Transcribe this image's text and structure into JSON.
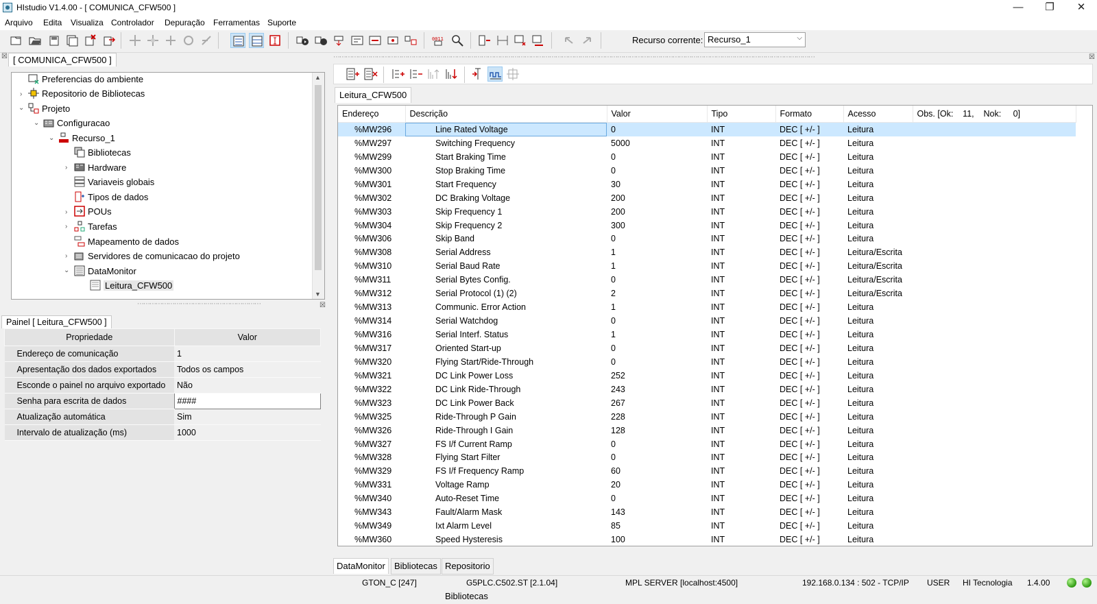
{
  "window": {
    "title": "HIstudio V1.4.00 - [ COMUNICA_CFW500 ]"
  },
  "menu": [
    "Arquivo",
    "Edita",
    "Visualiza",
    "Controlador",
    "Depuração",
    "Ferramentas",
    "Suporte"
  ],
  "toolbar": {
    "resource_label": "Recurso corrente:",
    "resource_value": "Recurso_1"
  },
  "left": {
    "project_tab": "[ COMUNICA_CFW500 ]",
    "tree": [
      {
        "label": "Preferencias do ambiente",
        "icon": "preferences-icon"
      },
      {
        "label": "Repositorio de Bibliotecas",
        "icon": "repository-icon"
      },
      {
        "label": "Projeto",
        "icon": "project-icon"
      },
      {
        "label": "Configuracao",
        "icon": "configuration-icon"
      },
      {
        "label": "Recurso_1",
        "icon": "resource-icon"
      },
      {
        "label": "Bibliotecas",
        "icon": "libraries-icon"
      },
      {
        "label": "Hardware",
        "icon": "hardware-icon"
      },
      {
        "label": "Variaveis globais",
        "icon": "global-variables-icon"
      },
      {
        "label": "Tipos de dados",
        "icon": "data-types-icon"
      },
      {
        "label": "POUs",
        "icon": "pous-icon"
      },
      {
        "label": "Tarefas",
        "icon": "tasks-icon"
      },
      {
        "label": "Mapeamento de dados",
        "icon": "data-mapping-icon"
      },
      {
        "label": "Servidores de comunicacao do projeto",
        "icon": "comm-servers-icon"
      },
      {
        "label": "DataMonitor",
        "icon": "datamonitor-icon"
      },
      {
        "label": "Leitura_CFW500",
        "icon": "panel-icon"
      }
    ],
    "panel_tab": "Painel [ Leitura_CFW500 ]",
    "props_headers": [
      "Propriedade",
      "Valor"
    ],
    "props": [
      {
        "name": "Endereço de comunicação",
        "value": "1"
      },
      {
        "name": "Apresentação dos dados exportados",
        "value": "Todos os campos"
      },
      {
        "name": "Esconde o painel no arquivo exportado",
        "value": "Não"
      },
      {
        "name": "Senha para escrita de dados",
        "value": "####"
      },
      {
        "name": "Atualização automática",
        "value": "Sim"
      },
      {
        "name": "Intervalo de atualização (ms)",
        "value": "1000"
      }
    ]
  },
  "right": {
    "doc_tab": "Leitura_CFW500",
    "columns": [
      "Endereço",
      "Descrição",
      "Valor",
      "Tipo",
      "Formato",
      "Acesso",
      "Obs. [Ok:    11,    Nok:     0]"
    ],
    "rows": [
      [
        "%MW296",
        "Line Rated Voltage",
        "0",
        "INT",
        "DEC [ +/- ]",
        "Leitura"
      ],
      [
        "%MW297",
        "Switching Frequency",
        "5000",
        "INT",
        "DEC [ +/- ]",
        "Leitura"
      ],
      [
        "%MW299",
        "Start Braking Time",
        "0",
        "INT",
        "DEC [ +/- ]",
        "Leitura"
      ],
      [
        "%MW300",
        "Stop Braking Time",
        "0",
        "INT",
        "DEC [ +/- ]",
        "Leitura"
      ],
      [
        "%MW301",
        "Start Frequency",
        "30",
        "INT",
        "DEC [ +/- ]",
        "Leitura"
      ],
      [
        "%MW302",
        "DC Braking Voltage",
        "200",
        "INT",
        "DEC [ +/- ]",
        "Leitura"
      ],
      [
        "%MW303",
        "Skip Frequency 1",
        "200",
        "INT",
        "DEC [ +/- ]",
        "Leitura"
      ],
      [
        "%MW304",
        "Skip Frequency 2",
        "300",
        "INT",
        "DEC [ +/- ]",
        "Leitura"
      ],
      [
        "%MW306",
        "Skip Band",
        "0",
        "INT",
        "DEC [ +/- ]",
        "Leitura"
      ],
      [
        "%MW308",
        "Serial Address",
        "1",
        "INT",
        "DEC [ +/- ]",
        "Leitura/Escrita"
      ],
      [
        "%MW310",
        "Serial Baud Rate",
        "1",
        "INT",
        "DEC [ +/- ]",
        "Leitura/Escrita"
      ],
      [
        "%MW311",
        "Serial Bytes Config.",
        "0",
        "INT",
        "DEC [ +/- ]",
        "Leitura/Escrita"
      ],
      [
        "%MW312",
        "Serial Protocol (1) (2)",
        "2",
        "INT",
        "DEC [ +/- ]",
        "Leitura/Escrita"
      ],
      [
        "%MW313",
        "Communic. Error Action",
        "1",
        "INT",
        "DEC [ +/- ]",
        "Leitura"
      ],
      [
        "%MW314",
        "Serial Watchdog",
        "0",
        "INT",
        "DEC [ +/- ]",
        "Leitura"
      ],
      [
        "%MW316",
        "Serial Interf. Status",
        "1",
        "INT",
        "DEC [ +/- ]",
        "Leitura"
      ],
      [
        "%MW317",
        "Oriented Start-up",
        "0",
        "INT",
        "DEC [ +/- ]",
        "Leitura"
      ],
      [
        "%MW320",
        "Flying Start/Ride-Through",
        "0",
        "INT",
        "DEC [ +/- ]",
        "Leitura"
      ],
      [
        "%MW321",
        "DC Link Power Loss",
        "252",
        "INT",
        "DEC [ +/- ]",
        "Leitura"
      ],
      [
        "%MW322",
        "DC Link Ride-Through",
        "243",
        "INT",
        "DEC [ +/- ]",
        "Leitura"
      ],
      [
        "%MW323",
        "DC Link Power Back",
        "267",
        "INT",
        "DEC [ +/- ]",
        "Leitura"
      ],
      [
        "%MW325",
        "Ride-Through P Gain",
        "228",
        "INT",
        "DEC [ +/- ]",
        "Leitura"
      ],
      [
        "%MW326",
        "Ride-Through I Gain",
        "128",
        "INT",
        "DEC [ +/- ]",
        "Leitura"
      ],
      [
        "%MW327",
        "FS I/f Current Ramp",
        "0",
        "INT",
        "DEC [ +/- ]",
        "Leitura"
      ],
      [
        "%MW328",
        "Flying Start Filter",
        "0",
        "INT",
        "DEC [ +/- ]",
        "Leitura"
      ],
      [
        "%MW329",
        "FS I/f Frequency Ramp",
        "60",
        "INT",
        "DEC [ +/- ]",
        "Leitura"
      ],
      [
        "%MW331",
        "Voltage Ramp",
        "20",
        "INT",
        "DEC [ +/- ]",
        "Leitura"
      ],
      [
        "%MW340",
        "Auto-Reset Time",
        "0",
        "INT",
        "DEC [ +/- ]",
        "Leitura"
      ],
      [
        "%MW343",
        "Fault/Alarm Mask",
        "143",
        "INT",
        "DEC [ +/- ]",
        "Leitura"
      ],
      [
        "%MW349",
        "Ixt Alarm Level",
        "85",
        "INT",
        "DEC [ +/- ]",
        "Leitura"
      ],
      [
        "%MW360",
        "Speed Hysteresis",
        "100",
        "INT",
        "DEC [ +/- ]",
        "Leitura"
      ]
    ],
    "bottom_tabs": [
      "DataMonitor",
      "Bibliotecas",
      "Repositorio de Bibliotecas"
    ]
  },
  "status": {
    "s1": "GTON_C [247]",
    "s2": "G5PLC.C502.ST [2.1.04]",
    "s3": "MPL SERVER [localhost:4500]",
    "s4": "192.168.0.134 : 502 - TCP/IP",
    "s5": "USER",
    "s6": "HI Tecnologia",
    "s7": "1.4.00"
  },
  "colors": {
    "selection": "#cce8ff",
    "led": "#2f9a12",
    "toolbar_pressed": "#cce4f7"
  }
}
